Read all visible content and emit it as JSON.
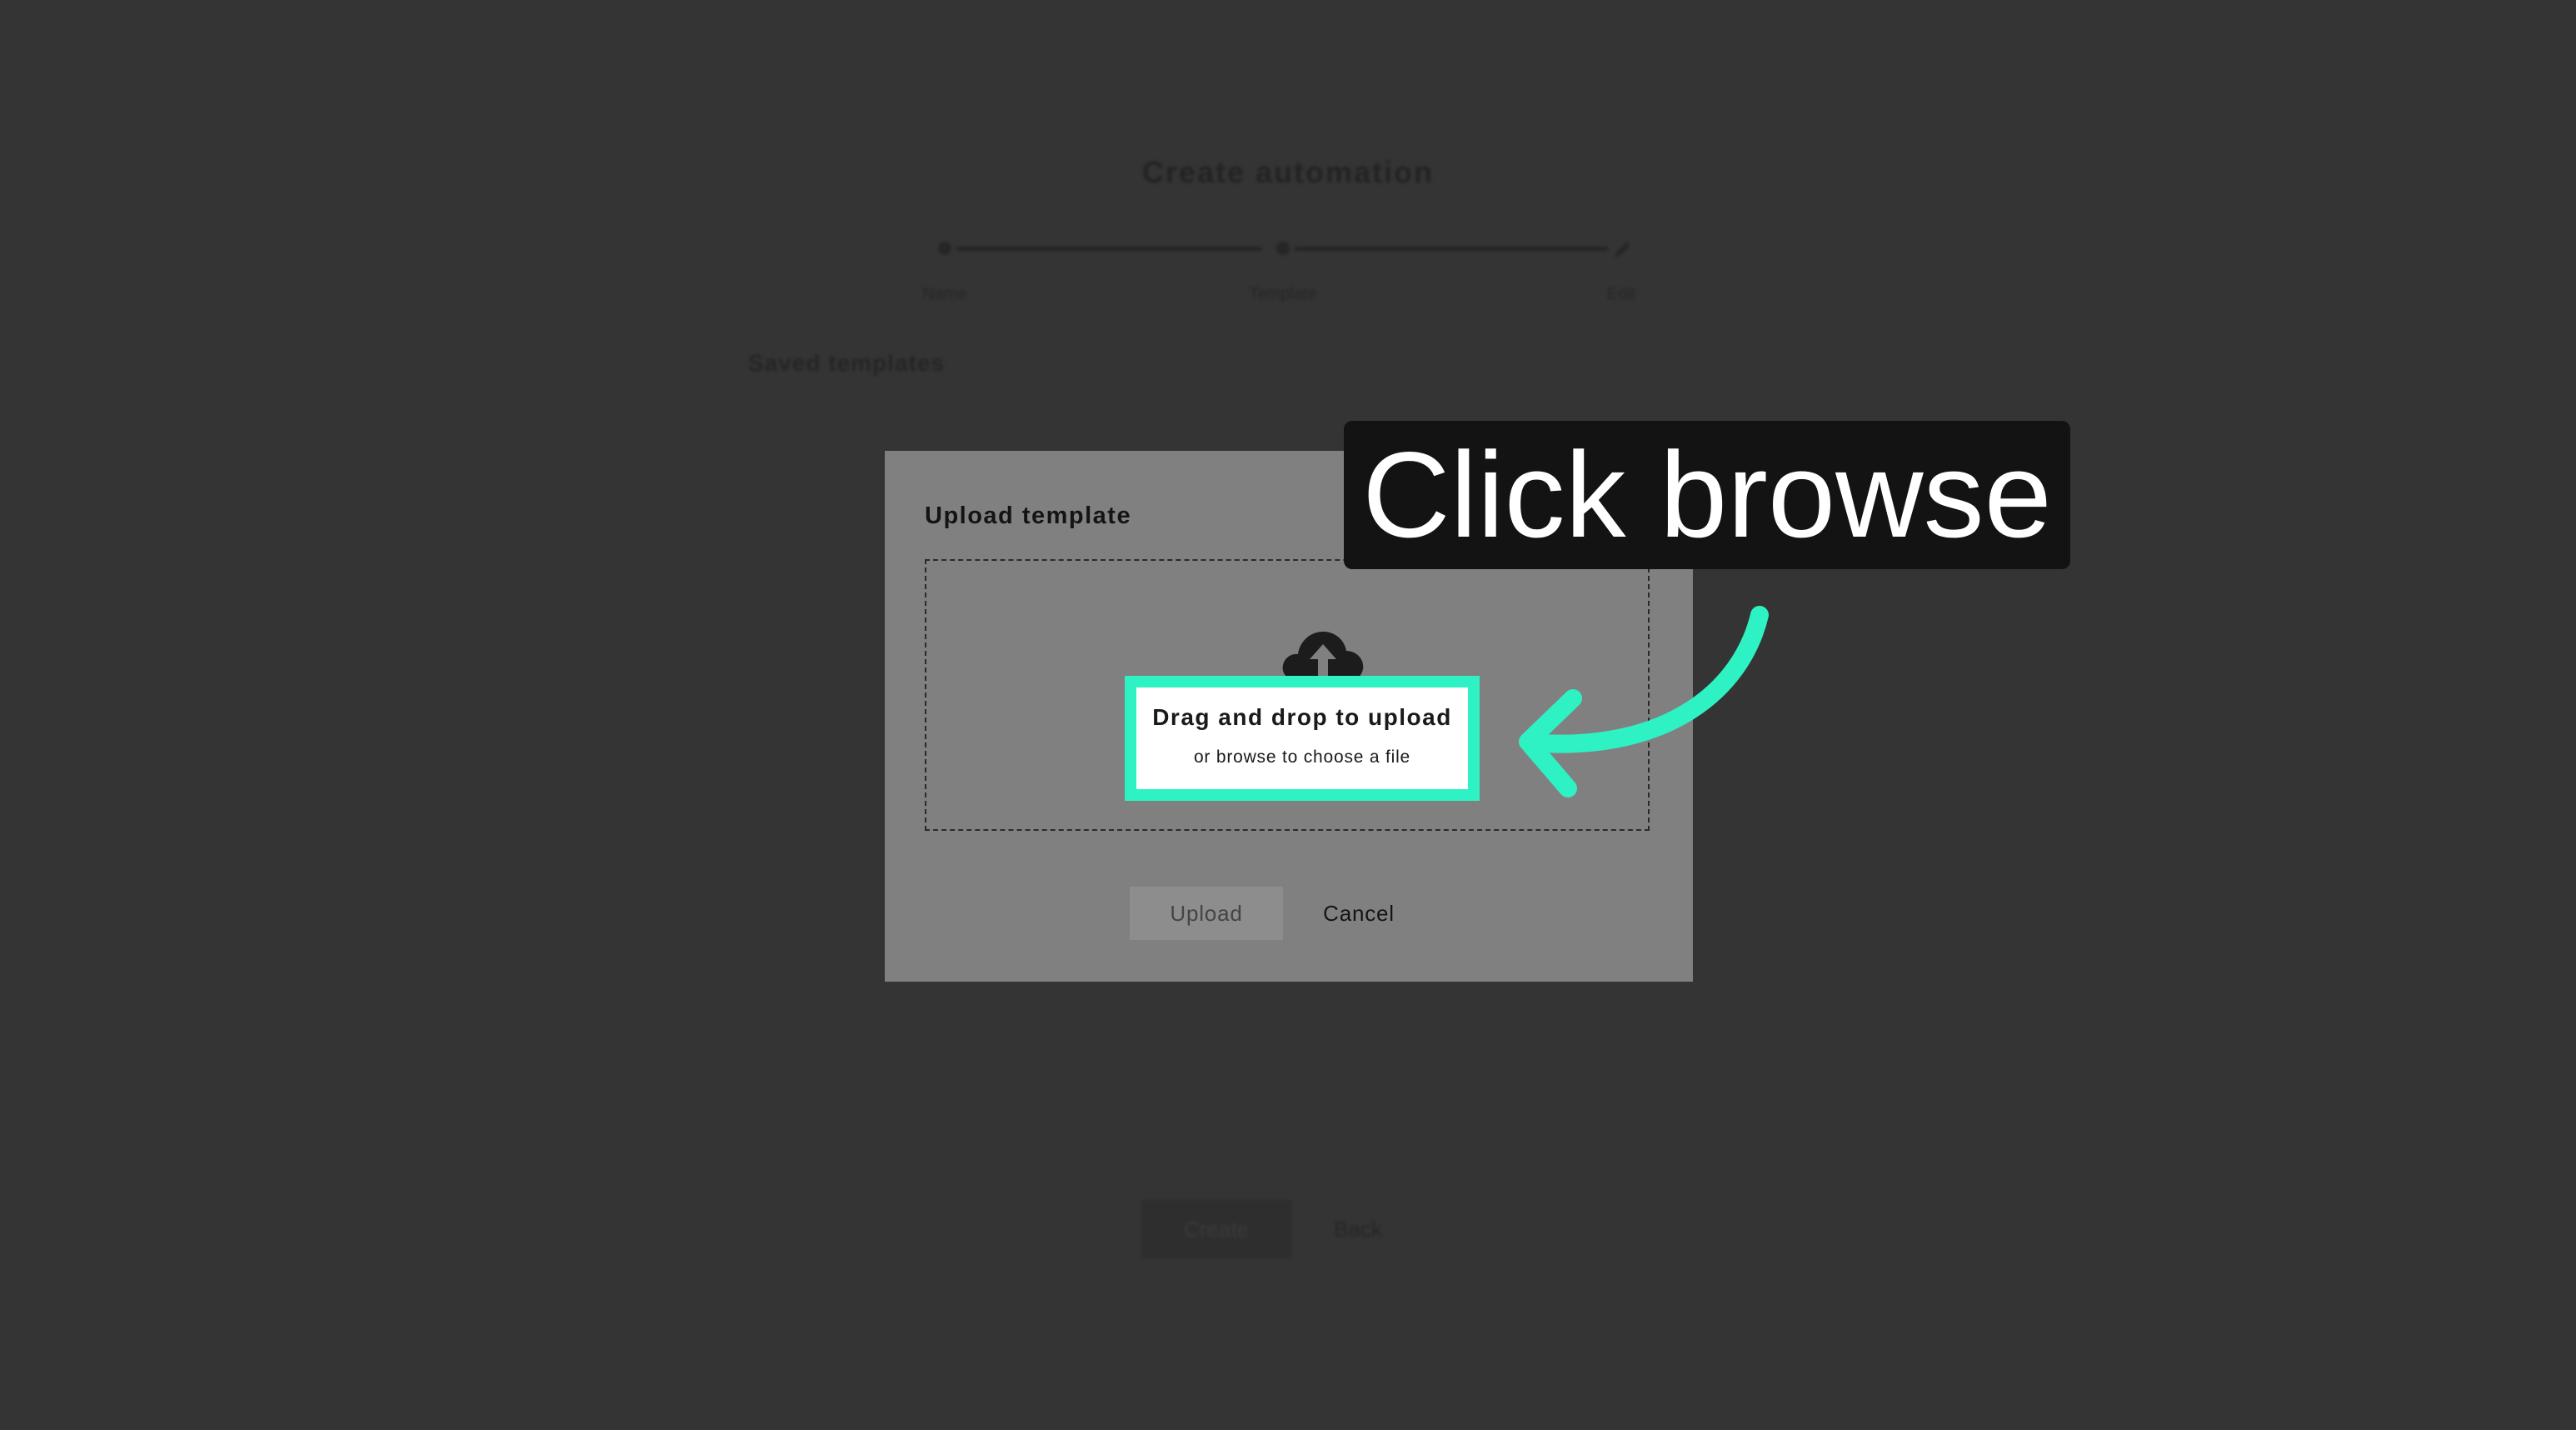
{
  "page": {
    "title": "Create automation",
    "steps": [
      {
        "label": "Name"
      },
      {
        "label": "Template"
      },
      {
        "label": "Edit"
      }
    ],
    "section_heading": "Saved templates",
    "create_label": "Create",
    "back_label": "Back"
  },
  "modal": {
    "title": "Upload template",
    "dropzone": {
      "icon": "cloud-upload-icon",
      "main_text": "Drag and drop to upload",
      "sub_text": "or browse to choose a file"
    },
    "upload_label": "Upload",
    "cancel_label": "Cancel"
  },
  "callout": {
    "text": "Click browse",
    "arrow_icon": "curved-arrow-icon",
    "highlight_color": "#2ef2c3"
  }
}
